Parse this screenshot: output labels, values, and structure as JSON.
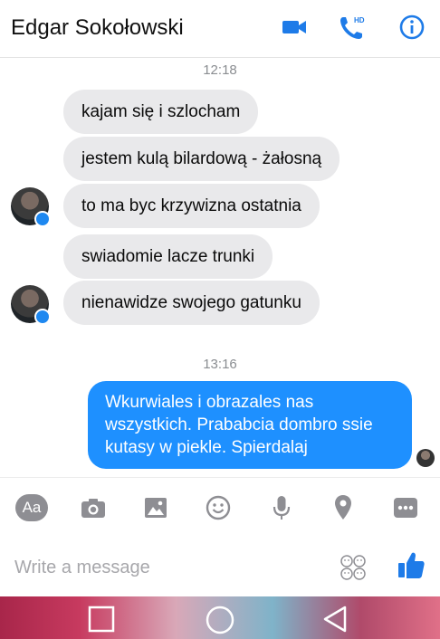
{
  "header": {
    "contact_name": "Edgar Sokołowski",
    "hd_badge": "HD",
    "accent_color": "#1e7be8"
  },
  "messages": {
    "time_1": "12:18",
    "incoming": [
      "kajam się i szlocham",
      "jestem kulą bilardową - żałosną",
      "to ma byc krzywizna ostatnia",
      "swiadomie lacze trunki",
      "nienawidze swojego gatunku"
    ],
    "time_2": "13:16",
    "outgoing": "Wkurwiales i obrazales nas wszystkich. Prababcia dombro ssie kutasy w piekle. Spierdalaj",
    "outgoing_color": "#1e90ff",
    "incoming_color": "#e9e9eb"
  },
  "toolbar": {
    "aa_label": "Aa",
    "icons": [
      "camera-icon",
      "image-icon",
      "emoji-icon",
      "microphone-icon",
      "location-icon",
      "more-icon"
    ]
  },
  "composer": {
    "placeholder": "Write a message",
    "value": ""
  },
  "navbar": {
    "icons": [
      "recent-apps-icon",
      "home-icon",
      "back-icon"
    ]
  }
}
